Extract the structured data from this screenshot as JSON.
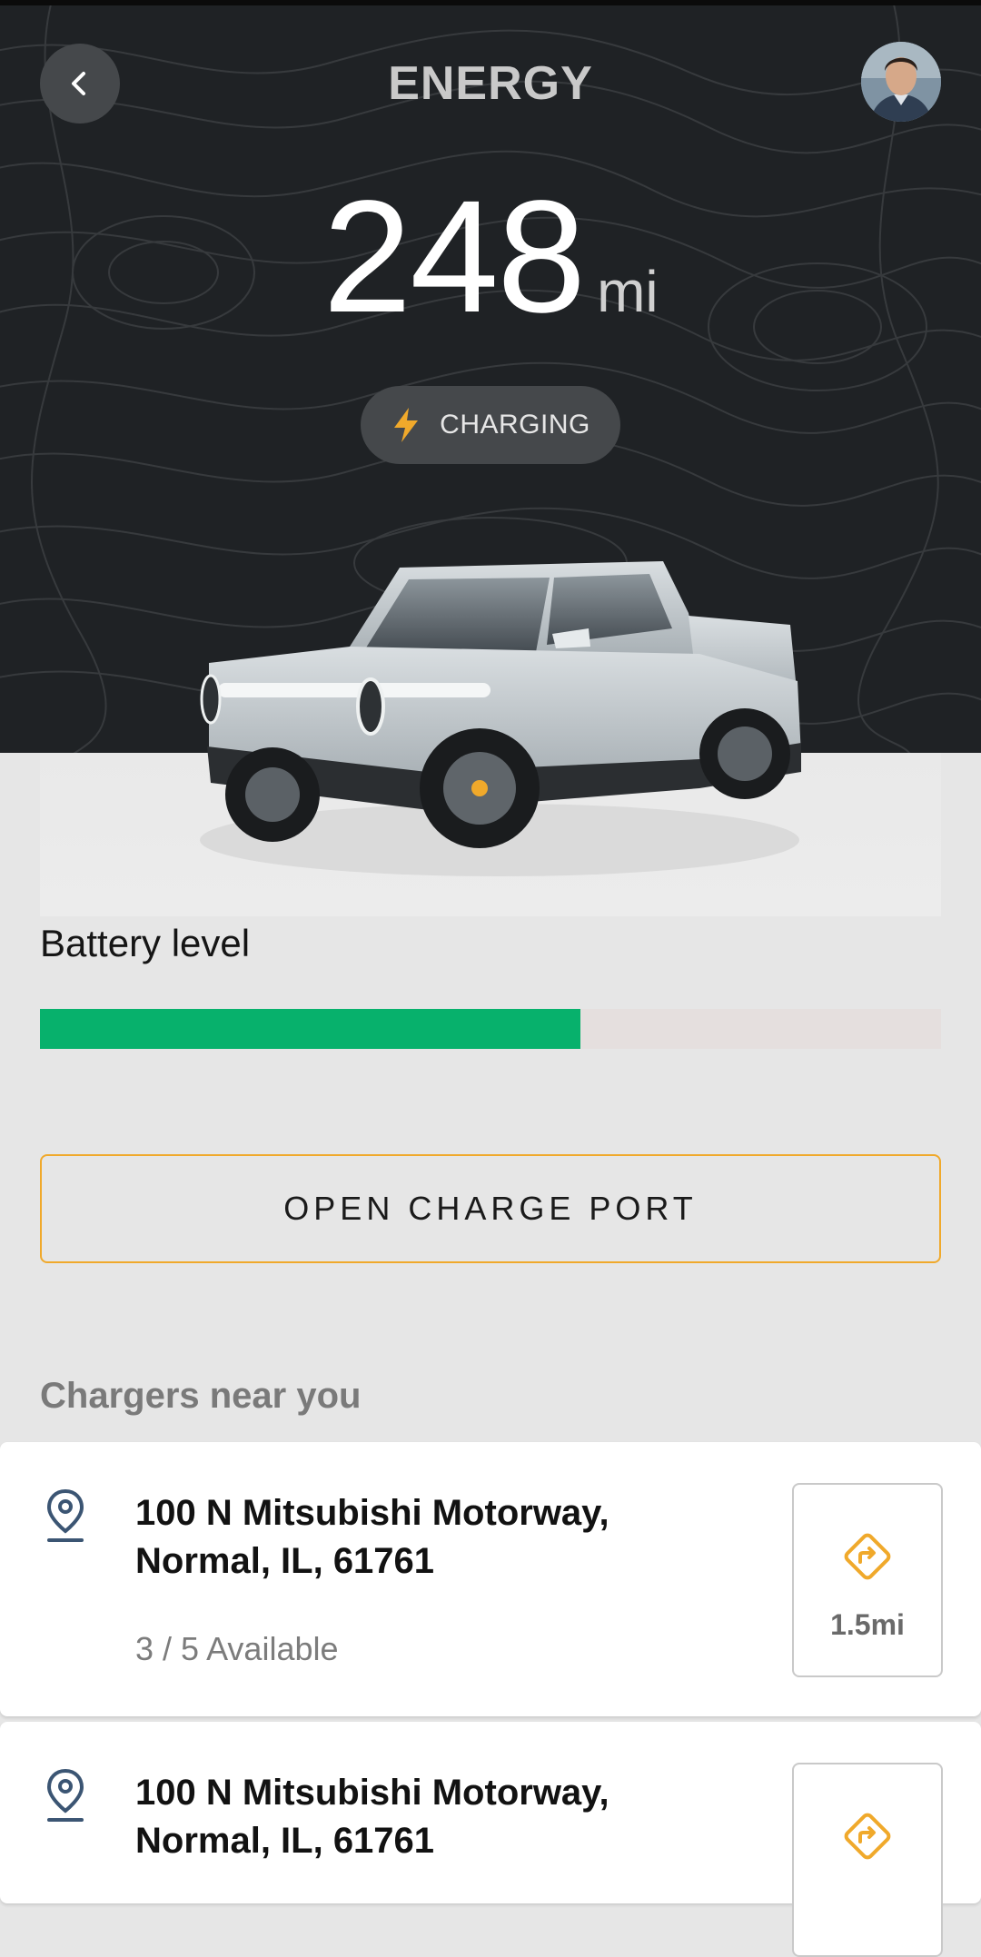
{
  "header": {
    "title": "ENERGY"
  },
  "range": {
    "value": "248",
    "unit": "mi"
  },
  "status": {
    "label": "CHARGING",
    "icon": "lightning-bolt-icon"
  },
  "battery": {
    "label": "Battery level",
    "level_percent": 60
  },
  "charge_port_button": {
    "label": "OPEN CHARGE PORT"
  },
  "chargers_section": {
    "title": "Chargers near you",
    "items": [
      {
        "address_line1": "100 N Mitsubishi Motorway,",
        "address_line2": "Normal, IL, 61761",
        "availability": "3 / 5 Available",
        "distance": "1.5mi"
      },
      {
        "address_line1": "100 N Mitsubishi Motorway,",
        "address_line2": "Normal, IL, 61761"
      }
    ]
  },
  "colors": {
    "accent": "#f0a92b",
    "battery_fill": "#07b16c",
    "hero_background": "#1f2225"
  }
}
